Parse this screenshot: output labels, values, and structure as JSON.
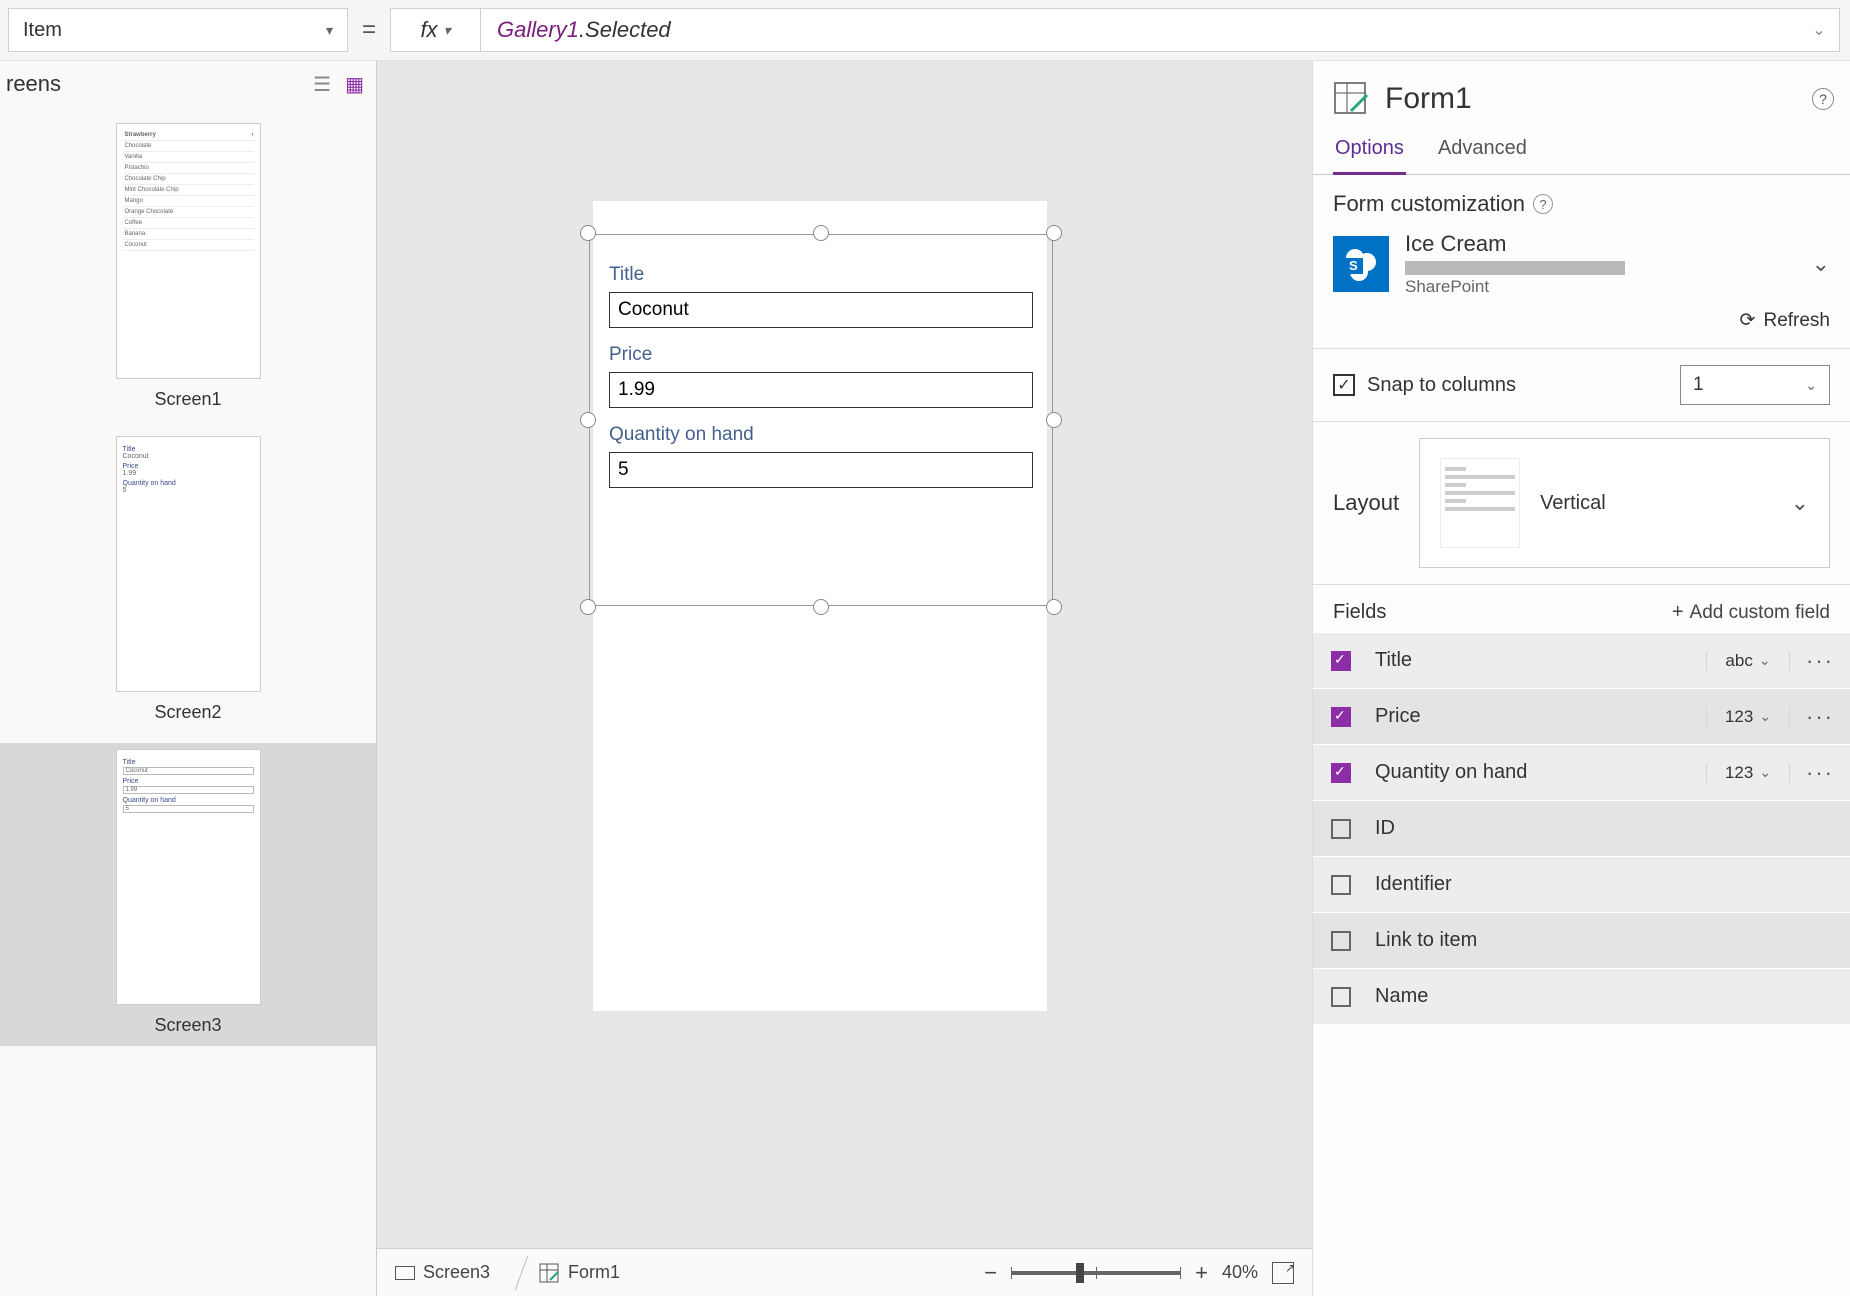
{
  "formula_bar": {
    "property": "Item",
    "fx_label": "fx",
    "identifier": "Gallery1",
    "suffix": ".Selected"
  },
  "left_panel": {
    "title": "reens",
    "screens": [
      {
        "label": "Screen1",
        "gallery_items": [
          "Strawberry",
          "Chocolate",
          "Vanilla",
          "Pistachio",
          "Chocolate Chip",
          "Mint Chocolate Chip",
          "Mango",
          "Orange Chocolate",
          "Coffee",
          "Banana",
          "Coconut"
        ]
      },
      {
        "label": "Screen2"
      },
      {
        "label": "Screen3"
      }
    ]
  },
  "canvas": {
    "form": {
      "fields": [
        {
          "label": "Title",
          "value": "Coconut"
        },
        {
          "label": "Price",
          "value": "1.99"
        },
        {
          "label": "Quantity on hand",
          "value": "5"
        }
      ]
    }
  },
  "status_bar": {
    "crumb1": "Screen3",
    "crumb2": "Form1",
    "zoom": "40%"
  },
  "right_panel": {
    "title": "Form1",
    "tabs": {
      "options": "Options",
      "advanced": "Advanced"
    },
    "form_customization": "Form customization",
    "datasource": {
      "name": "Ice Cream",
      "provider": "SharePoint"
    },
    "refresh": "Refresh",
    "snap_label": "Snap to columns",
    "snap_value": "1",
    "layout_label": "Layout",
    "layout_value": "Vertical",
    "fields_label": "Fields",
    "add_custom": "Add custom field",
    "fields": [
      {
        "name": "Title",
        "checked": true,
        "type": "abc"
      },
      {
        "name": "Price",
        "checked": true,
        "type": "123"
      },
      {
        "name": "Quantity on hand",
        "checked": true,
        "type": "123"
      },
      {
        "name": "ID",
        "checked": false
      },
      {
        "name": "Identifier",
        "checked": false
      },
      {
        "name": "Link to item",
        "checked": false
      },
      {
        "name": "Name",
        "checked": false
      }
    ]
  }
}
